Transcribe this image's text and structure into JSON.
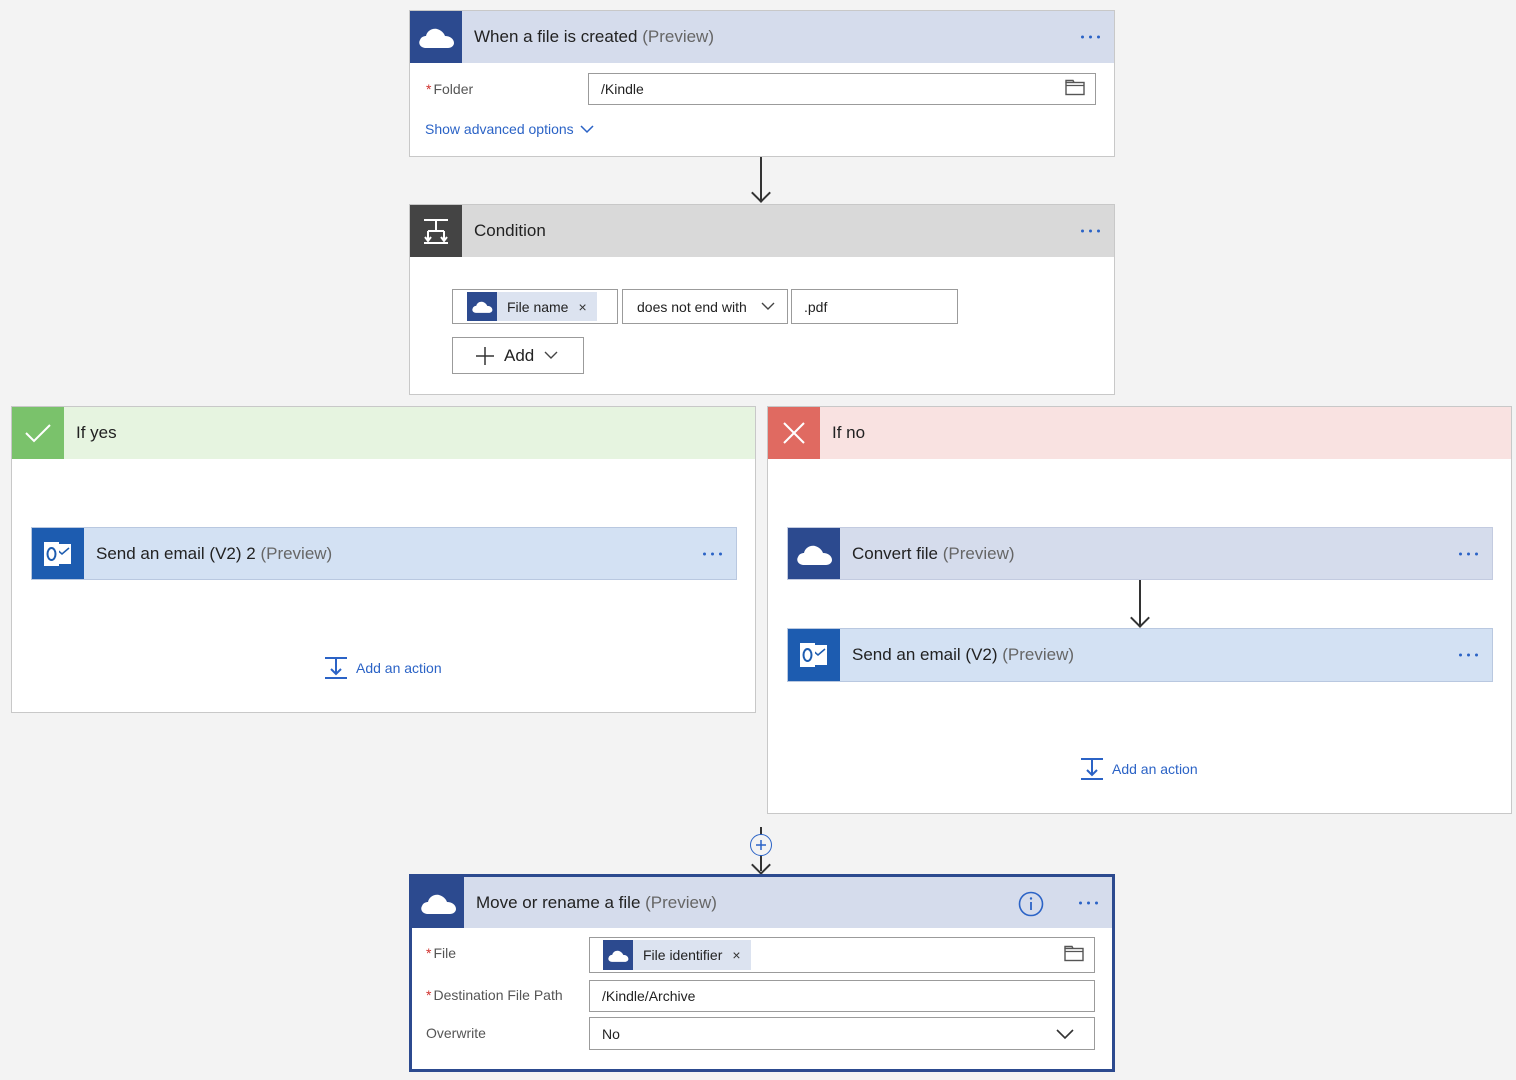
{
  "trigger": {
    "title": "When a file is created",
    "preview": "(Preview)",
    "icon": "onedrive-cloud-icon",
    "folder_label": "Folder",
    "folder_value": "/Kindle",
    "advanced_link": "Show advanced options"
  },
  "condition": {
    "title": "Condition",
    "icon": "condition-icon",
    "token_label": "File name",
    "token_remove": "×",
    "operator": "does not end with",
    "value": ".pdf",
    "add_label": "Add"
  },
  "if_yes": {
    "title": "If yes",
    "color": "#7ac26b",
    "action_title": "Send an email (V2) 2",
    "action_preview": "(Preview)",
    "add_action": "Add an action"
  },
  "if_no": {
    "title": "If no",
    "color": "#e06a61",
    "convert_title": "Convert file",
    "convert_preview": "(Preview)",
    "email_title": "Send an email (V2)",
    "email_preview": "(Preview)",
    "add_action": "Add an action"
  },
  "move": {
    "title": "Move or rename a file",
    "preview": "(Preview)",
    "file_label": "File",
    "file_token": "File identifier",
    "file_token_remove": "×",
    "dest_label": "Destination File Path",
    "dest_value": "/Kindle/Archive",
    "overwrite_label": "Overwrite",
    "overwrite_value": "No"
  },
  "colors": {
    "accent_link": "#2b63c6",
    "onedrive": "#2c4a8f",
    "outlook": "#1d5cb0",
    "selected_border": "#2c4a8f"
  }
}
